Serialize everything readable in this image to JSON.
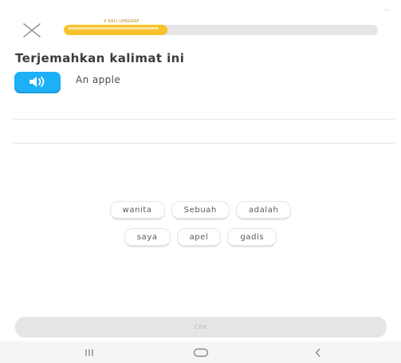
{
  "header": {
    "close_icon": "close-x-icon",
    "progress_percent": 33,
    "progress_caption": "4 KALI LENGKAP",
    "corner_mark": "—"
  },
  "challenge": {
    "title": "Terjemahkan kalimat ini",
    "speaker_icon": "speaker-icon",
    "sentence": "An apple"
  },
  "word_bank": {
    "rows": [
      [
        "wanita",
        "Sebuah",
        "adalah"
      ],
      [
        "saya",
        "apel",
        "gadis"
      ]
    ]
  },
  "footer": {
    "check_label": "CEK"
  },
  "system_nav": {
    "recents_icon": "recents-icon",
    "home_icon": "home-icon",
    "back_icon": "back-icon"
  },
  "colors": {
    "progress": "#f7c12b",
    "speaker": "#1cb0f6",
    "check_disabled": "#e5e5e5"
  }
}
